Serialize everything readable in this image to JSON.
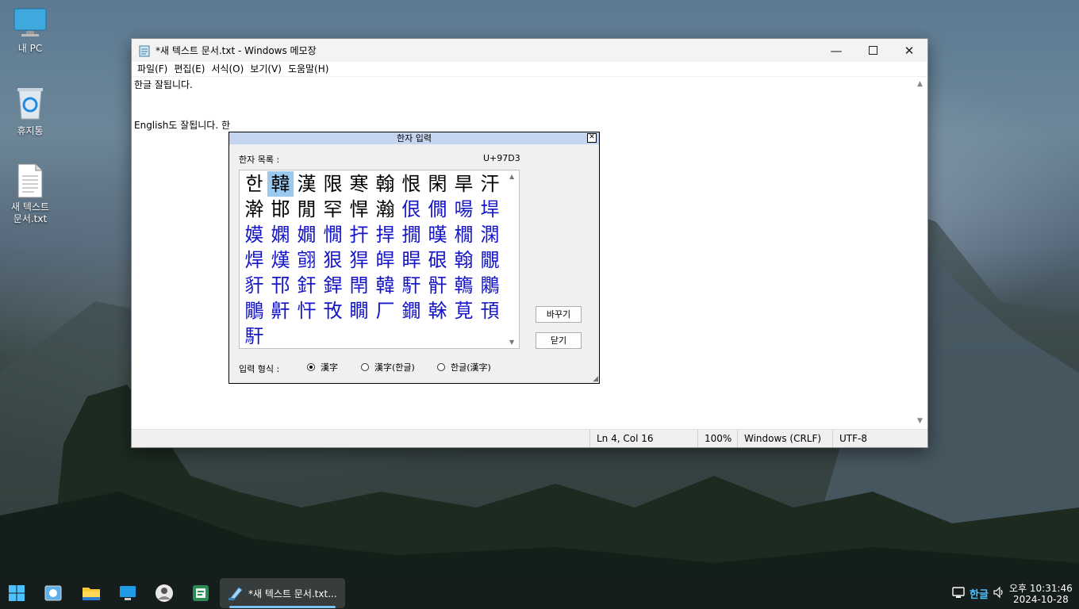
{
  "desktop": {
    "icons": [
      {
        "label": "내 PC",
        "icon": "monitor-icon"
      },
      {
        "label": "휴지통",
        "icon": "recycle-bin-icon"
      },
      {
        "label": "새 텍스트 문서.txt",
        "icon": "text-file-icon"
      }
    ]
  },
  "notepad": {
    "title": "*새 텍스트 문서.txt - Windows 메모장",
    "menu": [
      "파일(F)",
      "편집(E)",
      "서식(O)",
      "보기(V)",
      "도움말(H)"
    ],
    "content": "한글 잘됩니다.\n\n\nEnglish도 잘됩니다. 한",
    "status": {
      "position": "Ln 4, Col 16",
      "zoom": "100%",
      "line_ending": "Windows (CRLF)",
      "encoding": "UTF-8"
    }
  },
  "hanja_dialog": {
    "title": "한자 입력",
    "list_label": "한자 목록 :",
    "codepoint": "U+97D3",
    "first_char": "한",
    "chars_black": [
      "韓",
      "漢",
      "限",
      "寒",
      "翰",
      "恨",
      "閑",
      "旱",
      "汗",
      "澣",
      "邯",
      "閒",
      "罕",
      "悍",
      "瀚"
    ],
    "chars_blue": [
      "佷",
      "僩",
      "啺",
      "垾",
      "嫫",
      "嫻",
      "嫺",
      "憪",
      "扞",
      "捍",
      "撊",
      "暵",
      "橌",
      "澖",
      "焊",
      "熯",
      "翧",
      "狠",
      "猂",
      "皔",
      "睅",
      "硍",
      "翰",
      "覵",
      "豻",
      "邗",
      "釬",
      "銲",
      "閈",
      "韓",
      "馯",
      "骭",
      "鶾",
      "鷴",
      "鷳",
      "鼾",
      "忓",
      "攼",
      "瞯",
      "厂",
      "鐗",
      "榦",
      "莧",
      "頇",
      "馯"
    ],
    "replace_button": "바꾸기",
    "close_button": "닫기",
    "input_format_label": "입력 형식 :",
    "formats": [
      {
        "label": "漢字",
        "selected": true
      },
      {
        "label": "漢字(한글)",
        "selected": false
      },
      {
        "label": "한글(漢字)",
        "selected": false
      }
    ]
  },
  "taskbar": {
    "active_app_label": "*새 텍스트 문서.txt...",
    "ime_mode": "한글",
    "time_ampm": "오후 10:31:46",
    "date": "2024-10-28"
  }
}
